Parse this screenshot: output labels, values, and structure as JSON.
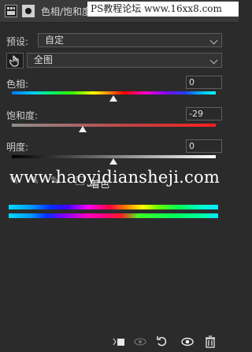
{
  "header": {
    "title": "色相/饱和度",
    "icons": [
      "adjustment-grid-icon",
      "layer-mask-icon"
    ]
  },
  "watermark": {
    "top": "PS教程论坛 www.16xx8.com",
    "middle": "www.haoyidiansheji.com"
  },
  "preset": {
    "label": "预设:",
    "value": "自定"
  },
  "channel": {
    "value": "全图"
  },
  "sliders": {
    "hue": {
      "label": "色相:",
      "value": "0"
    },
    "saturation": {
      "label": "饱和度:",
      "value": "-29"
    },
    "lightness": {
      "label": "明度:",
      "value": "0"
    }
  },
  "colorize": {
    "label": "着色",
    "checked": false
  },
  "footer_icons": [
    "clip-to-layer-icon",
    "view-previous-state-icon",
    "reset-icon",
    "visibility-icon",
    "delete-icon"
  ],
  "colors": {
    "panel_bg": "#2b2b2b",
    "header_bg": "#3a3a3a",
    "text": "#d6d6d6"
  }
}
